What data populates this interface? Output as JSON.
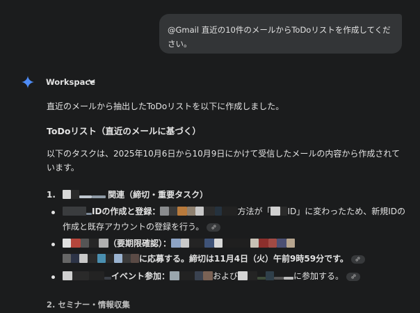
{
  "user_message": "@Gmail 直近の10件のメールからToDoリストを作成してください。",
  "model": {
    "name": "Workspace"
  },
  "response": {
    "intro": "直近のメールから抽出したToDoリストを以下に作成しました。",
    "heading": "ToDoリスト（直近のメールに基づく）",
    "description": "以下のタスクは、2025年10月6日から10月9日にかけて受信したメールの内容から作成されています。",
    "section1": {
      "number": "1.",
      "title": "関連（締切・重要タスク）",
      "items": [
        {
          "bold": "IDの作成と登録：",
          "mid1": "方法が「",
          "mid2": "ID」に変わったため、新規IDの作成と既存アカウントの登録を行う。"
        },
        {
          "bold": "（要期限確認）：",
          "bold2": "に応募する。締切は11月4日（火）午前9時59分です。"
        },
        {
          "bold": "イベント参加：",
          "mid1": "および",
          "mid2": "に参加する。"
        }
      ]
    },
    "section2": {
      "title": "2. セミナー・情報収集"
    }
  },
  "icons": {
    "spark": "gemini-spark-icon",
    "chevron": "chevron-down-icon",
    "link": "link-icon"
  },
  "colors": {
    "background": "#1b1c1d",
    "bubble": "#333537",
    "text": "#e3e3e3",
    "spark": "#4e8cf7"
  }
}
